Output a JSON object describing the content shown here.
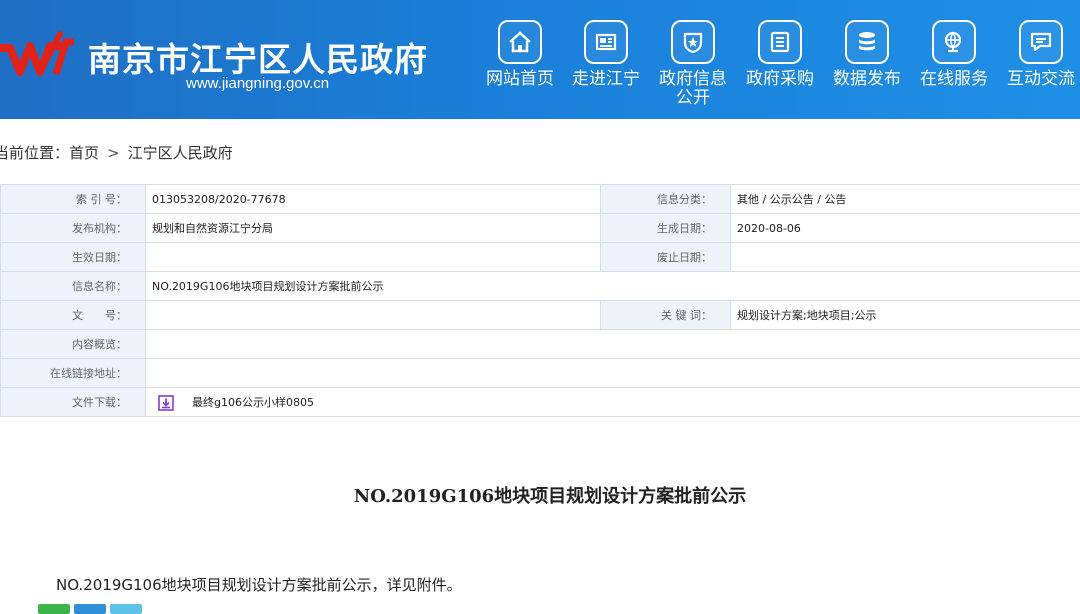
{
  "header": {
    "site_title": "南京市江宁区人民政府",
    "site_url": "www.jiangning.gov.cn",
    "nav": [
      {
        "label": "网站首页",
        "icon": "home-icon"
      },
      {
        "label": "走进江宁",
        "icon": "newspaper-icon"
      },
      {
        "label": "政府信息\n公开",
        "icon": "shield-star-icon"
      },
      {
        "label": "政府采购",
        "icon": "list-icon"
      },
      {
        "label": "数据发布",
        "icon": "database-icon"
      },
      {
        "label": "在线服务",
        "icon": "globe-person-icon"
      },
      {
        "label": "互动交流",
        "icon": "chat-icon"
      }
    ]
  },
  "breadcrumb": {
    "prefix": "当前位置：",
    "home": "首页",
    "separator": ">",
    "current": "江宁区人民政府"
  },
  "info": {
    "index_label": "索 引 号：",
    "index_value": "013053208/2020-77678",
    "category_label": "信息分类：",
    "category_value": "其他 / 公示公告 / 公告",
    "publisher_label": "发布机构：",
    "publisher_value": "规划和自然资源江宁分局",
    "generated_label": "生成日期：",
    "generated_value": "2020-08-06",
    "effective_label": "生效日期：",
    "effective_value": "",
    "abolished_label": "废止日期：",
    "abolished_value": "",
    "name_label": "信息名称：",
    "name_value": "NO.2019G106地块项目规划设计方案批前公示",
    "docno_label": "文　　号：",
    "docno_value": "",
    "keywords_label": "关 键 词：",
    "keywords_value": "规划设计方案;地块项目;公示",
    "overview_label": "内容概览：",
    "overview_value": "",
    "link_label": "在线链接地址：",
    "link_value": "",
    "download_label": "文件下载：",
    "download_file": "最终g106公示小样0805"
  },
  "article": {
    "title": "NO.2019G106地块项目规划设计方案批前公示",
    "body": "NO.2019G106地块项目规划设计方案批前公示，详见附件。"
  },
  "colors": {
    "header_blue": "#1a7fd8",
    "logo_red": "#e2231a",
    "label_bg": "#eef3fa",
    "border": "#d5dde6",
    "download_purple": "#8a3ccf",
    "share_green": "#3bb54a",
    "share_blue": "#2f8fd8",
    "share_teal": "#5cc3e6"
  }
}
